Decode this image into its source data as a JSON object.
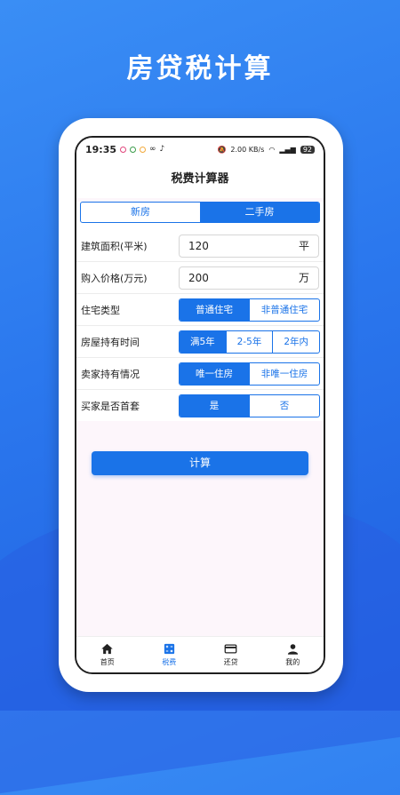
{
  "headline": "房贷税计算",
  "status": {
    "time": "19:35",
    "speed": "2.00 KB/s",
    "battery": "92"
  },
  "app_title": "税费计算器",
  "house_type_tabs": [
    "新房",
    "二手房"
  ],
  "selected_house_type": "二手房",
  "fields": {
    "area": {
      "label": "建筑面积(平米)",
      "value": "120",
      "unit": "平"
    },
    "price": {
      "label": "购入价格(万元)",
      "value": "200",
      "unit": "万"
    }
  },
  "options": {
    "residence_type": {
      "label": "住宅类型",
      "choices": [
        "普通住宅",
        "非普通住宅"
      ],
      "selected": "普通住宅"
    },
    "holding_time": {
      "label": "房屋持有时间",
      "choices": [
        "满5年",
        "2-5年",
        "2年内"
      ],
      "selected": "满5年"
    },
    "seller_status": {
      "label": "卖家持有情况",
      "choices": [
        "唯一住房",
        "非唯一住房"
      ],
      "selected": "唯一住房"
    },
    "buyer_first": {
      "label": "买家是否首套",
      "choices": [
        "是",
        "否"
      ],
      "selected": "是"
    }
  },
  "calculate_label": "计算",
  "tabbar": [
    {
      "label": "首页",
      "icon": "home-icon"
    },
    {
      "label": "税费",
      "icon": "calculator-icon"
    },
    {
      "label": "还贷",
      "icon": "card-icon"
    },
    {
      "label": "我的",
      "icon": "person-icon"
    }
  ],
  "active_tab": "税费",
  "colors": {
    "accent": "#1a73e8",
    "background": "#2b78ee"
  }
}
